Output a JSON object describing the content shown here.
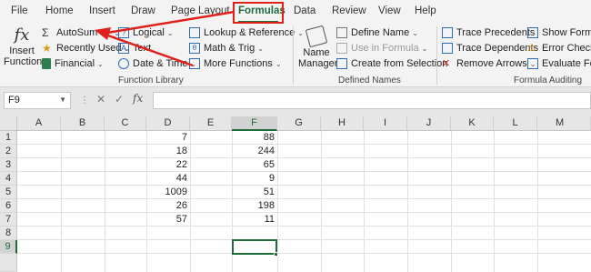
{
  "tabs": [
    "File",
    "Home",
    "Insert",
    "Draw",
    "Page Layout",
    "Formulas",
    "Data",
    "Review",
    "View",
    "Help"
  ],
  "active_tab": "Formulas",
  "function_library": {
    "insert_function": [
      "Insert",
      "Function"
    ],
    "autosum": "AutoSum",
    "recently_used": "Recently Used",
    "financial": "Financial",
    "logical": "Logical",
    "text": "Text",
    "date_time": "Date & Time",
    "lookup": "Lookup & Reference",
    "math": "Math & Trig",
    "more": "More Functions",
    "label": "Function Library"
  },
  "defined_names": {
    "name_manager": [
      "Name",
      "Manager"
    ],
    "define_name": "Define Name",
    "use_in_formula": "Use in Formula",
    "create_from_selection": "Create from Selection",
    "label": "Defined Names"
  },
  "formula_auditing": {
    "trace_precedents": "Trace Precedents",
    "trace_dependents": "Trace Dependents",
    "remove_arrows": "Remove Arrows",
    "show_formulas": "Show Formul",
    "error_checking": "Error Checkin",
    "evaluate_formula": "Evaluate Form",
    "label": "Formula Auditing"
  },
  "name_box": "F9",
  "fx_symbol": "fx",
  "columns": [
    "A",
    "B",
    "C",
    "D",
    "E",
    "F",
    "G",
    "H",
    "I",
    "J",
    "K",
    "L",
    "M"
  ],
  "rows": [
    "1",
    "2",
    "3",
    "4",
    "5",
    "6",
    "7",
    "8",
    "9"
  ],
  "column_D": [
    "7",
    "18",
    "22",
    "44",
    "1009",
    "26",
    "57"
  ],
  "column_F": [
    "88",
    "244",
    "65",
    "9",
    "51",
    "198",
    "11"
  ],
  "colors": {
    "accent": "#1e6b3c",
    "highlight": "#e0201b"
  },
  "icons": [
    "fx-icon",
    "sigma-icon",
    "star-icon",
    "book-icon",
    "question-icon",
    "text-icon",
    "clock-icon",
    "lookup-icon",
    "math-icon",
    "more-functions-icon",
    "name-manager-icon",
    "define-name-icon",
    "use-in-formula-icon",
    "create-selection-icon",
    "trace-precedents-icon",
    "trace-dependents-icon",
    "remove-arrows-icon",
    "show-formulas-icon",
    "error-checking-icon",
    "evaluate-formula-icon"
  ]
}
